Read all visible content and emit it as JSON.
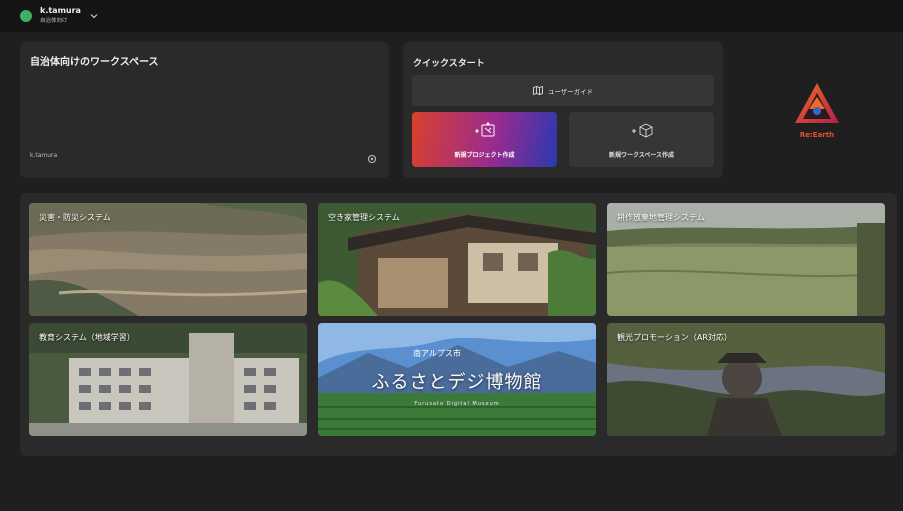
{
  "user": {
    "name": "k.tamura",
    "org": "自治体向け"
  },
  "workspace": {
    "title": "自治体向けのワークスペース",
    "owner": "k.tamura"
  },
  "quickstart": {
    "title": "クイックスタート",
    "guide_label": "ユーザーガイド",
    "new_project_label": "新規プロジェクト作成",
    "new_workspace_label": "新規ワークスペース作成"
  },
  "logo": {
    "text": "Re:Earth"
  },
  "projects": [
    {
      "label": "災害・防災システム"
    },
    {
      "label": "空き家管理システム"
    },
    {
      "label": "耕作放棄地管理システム"
    },
    {
      "label": "教育システム（地域学習）"
    },
    {
      "label": "",
      "museum_city": "南アルプス市",
      "museum_title": "ふるさとデジ博物館",
      "museum_sub": "Furusato Digital Museum"
    },
    {
      "label": "観光プロモーション（AR対応）"
    }
  ],
  "colors": {
    "accent_gradient": [
      "#d9412b",
      "#9b2b8e",
      "#2a39b0"
    ],
    "avatar": "#3fae6a",
    "brand": "#e8542a"
  }
}
